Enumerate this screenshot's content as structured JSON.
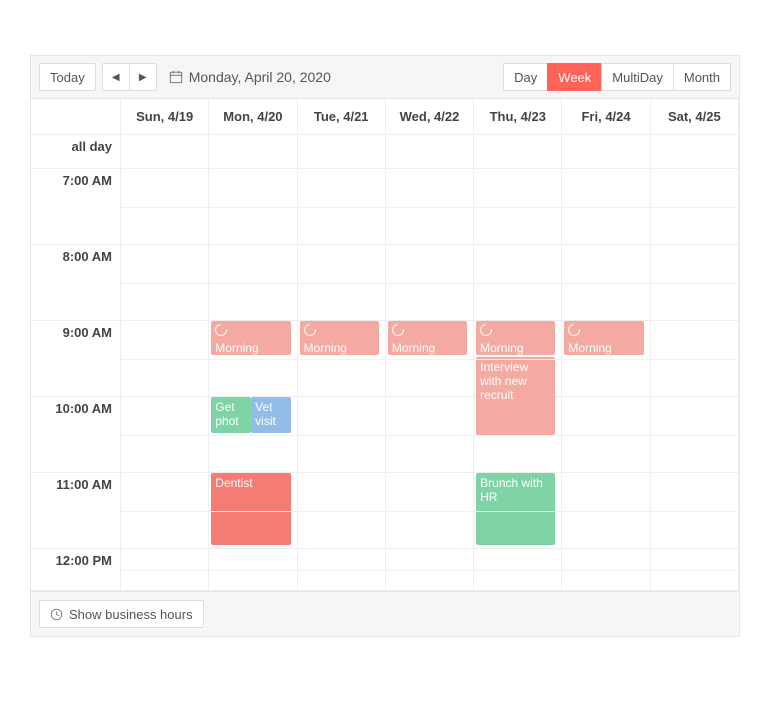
{
  "toolbar": {
    "today_label": "Today",
    "date_label": "Monday, April 20, 2020",
    "views": {
      "day": "Day",
      "week": "Week",
      "multiday": "MultiDay",
      "month": "Month",
      "active": "week"
    }
  },
  "columns": [
    "Sun, 4/19",
    "Mon, 4/20",
    "Tue, 4/21",
    "Wed, 4/22",
    "Thu, 4/23",
    "Fri, 4/24",
    "Sat, 4/25"
  ],
  "allday_label": "all day",
  "time_slots": [
    "7:00 AM",
    "8:00 AM",
    "9:00 AM",
    "10:00 AM",
    "11:00 AM",
    "12:00 PM"
  ],
  "events": {
    "morning": "Morning",
    "interview": "Interview with new recruit",
    "get_phot": "Get phot",
    "vet": "Vet visit",
    "dentist": "Dentist",
    "brunch": "Brunch with HR"
  },
  "footer": {
    "business_hours": "Show business hours"
  }
}
